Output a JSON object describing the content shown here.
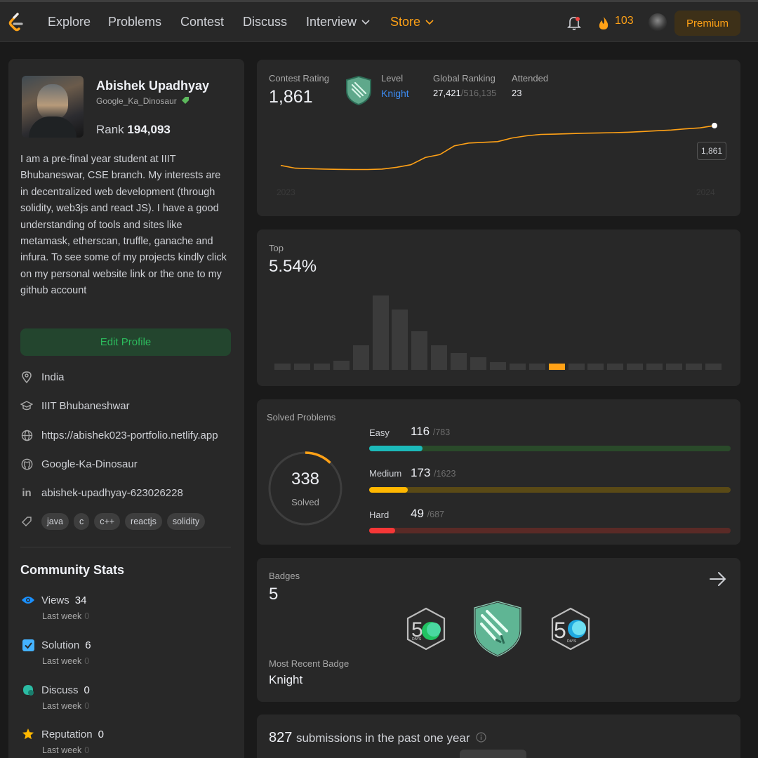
{
  "nav": {
    "links": [
      "Explore",
      "Problems",
      "Contest",
      "Discuss",
      "Interview",
      "Store"
    ],
    "streak": "103",
    "premium": "Premium",
    "accent": "#ffa116"
  },
  "profile": {
    "name": "Abishek Upadhyay",
    "handle": "Google_Ka_Dinosaur",
    "rank_label": "Rank",
    "rank_value": "194,093",
    "bio": "I am a pre-final year student at IIIT Bhubaneswar, CSE branch. My interests are in decentralized web development (through solidity, web3js and react JS). I have a good understanding of tools and sites like metamask, etherscan, truffle, ganache and infura. To see some of my projects kindly click on my personal website link or the one to my github account",
    "edit_button": "Edit Profile",
    "location": "India",
    "school": "IIIT Bhubaneshwar",
    "website": "https://abishek023-portfolio.netlify.app",
    "github": "Google-Ka-Dinosaur",
    "linkedin": "abishek-upadhyay-623026228",
    "skills": [
      "java",
      "c",
      "c++",
      "reactjs",
      "solidity"
    ]
  },
  "community": {
    "title": "Community Stats",
    "last_week_label": "Last week",
    "stats": [
      {
        "label": "Views",
        "value": "34",
        "last_week": "0",
        "icon": "eye-icon"
      },
      {
        "label": "Solution",
        "value": "6",
        "last_week": "0",
        "icon": "check-square-icon"
      },
      {
        "label": "Discuss",
        "value": "0",
        "last_week": "0",
        "icon": "chat-bubble-icon"
      },
      {
        "label": "Reputation",
        "value": "0",
        "last_week": "0",
        "icon": "star-icon"
      }
    ]
  },
  "contest": {
    "rating_label": "Contest Rating",
    "rating": "1,861",
    "level_label": "Level",
    "level": "Knight",
    "ranking_label": "Global Ranking",
    "ranking": "27,421",
    "ranking_total": "/516,135",
    "attended_label": "Attended",
    "attended": "23",
    "tooltip": "1,861",
    "x_start": "2023",
    "x_end": "2024"
  },
  "top": {
    "label": "Top",
    "value": "5.54%"
  },
  "solved": {
    "label": "Solved Problems",
    "total": "338",
    "total_label": "Solved",
    "easy": {
      "label": "Easy",
      "solved": 116,
      "total": 783,
      "total_text": "/783",
      "color": "#1cbaba",
      "track": "#2a4a2a"
    },
    "medium": {
      "label": "Medium",
      "solved": 173,
      "total": 1623,
      "total_text": "/1623",
      "color": "#ffb700",
      "track": "#5a4a16"
    },
    "hard": {
      "label": "Hard",
      "solved": 49,
      "total": 687,
      "total_text": "/687",
      "color": "#f63737",
      "track": "#5a2a26"
    }
  },
  "badges": {
    "label": "Badges",
    "count": "5",
    "recent_label": "Most Recent Badge",
    "recent": "Knight"
  },
  "submissions": {
    "count": "827",
    "text": "submissions in the past one year"
  },
  "chart_data": [
    {
      "type": "line",
      "title": "Contest Rating",
      "x_labels": [
        "2023",
        "2024"
      ],
      "series": [
        {
          "values": [
            1585,
            1566,
            1563,
            1560,
            1558,
            1557,
            1557,
            1560,
            1572,
            1590,
            1640,
            1660,
            1720,
            1740,
            1745,
            1750,
            1775,
            1790,
            1800,
            1802,
            1805,
            1808,
            1810,
            1812,
            1815,
            1820,
            1825,
            1830,
            1838,
            1845,
            1861
          ]
        }
      ],
      "last_value": 1861
    },
    {
      "type": "bar",
      "title": "Top",
      "values": [
        4,
        4,
        4,
        6,
        16,
        48,
        39,
        25,
        16,
        11,
        8,
        5,
        4,
        4,
        4,
        4,
        4,
        4,
        4,
        4,
        4,
        4,
        4
      ],
      "highlight_index": 14,
      "highlight_color": "#ffa116"
    }
  ]
}
